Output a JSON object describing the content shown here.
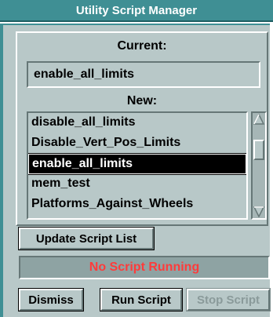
{
  "window": {
    "title": "Utility Script Manager"
  },
  "current": {
    "label": "Current:",
    "value": "enable_all_limits"
  },
  "new": {
    "label": "New:",
    "scripts": [
      "disable_all_limits",
      "Disable_Vert_Pos_Limits",
      "enable_all_limits",
      "mem_test",
      "Platforms_Against_Wheels"
    ],
    "selected_index": 2
  },
  "buttons": {
    "update": "Update Script List",
    "dismiss": "Dismiss",
    "run": "Run Script",
    "stop": "Stop Script"
  },
  "status": {
    "text": "No Script Running",
    "color": "#ff3b3b"
  },
  "colors": {
    "title_bg": "#3f8f94",
    "panel_bg": "#b8c8c8",
    "disabled_text": "#8a9a9a"
  },
  "icons": {
    "scroll_up": "scroll-up-arrow-icon",
    "scroll_down": "scroll-down-arrow-icon"
  }
}
